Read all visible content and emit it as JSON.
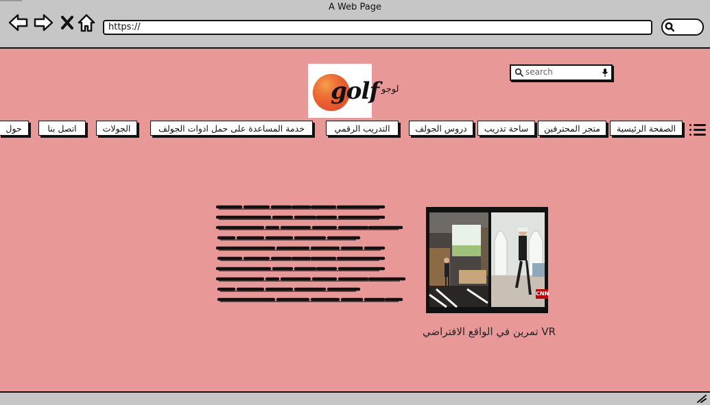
{
  "window": {
    "title": "A Web Page"
  },
  "address_bar": {
    "url": "https://"
  },
  "header": {
    "search_placeholder": "search",
    "logo_text": "golf",
    "logo_label": "لوجو"
  },
  "nav": {
    "items": [
      "الصفحة الرئيسية",
      "متجر المحترفين",
      "ساحة تدريب",
      "دروس الجولف",
      "التدريب الرقمي",
      "خدمة المساعدة على حمل ادوات الجولف",
      "الجولات",
      "اتصل بنا",
      "حول"
    ]
  },
  "feature": {
    "video_badge": "CNN",
    "caption": "VR تمرين في الواقع الافتراضي"
  },
  "colors": {
    "page_background": "#e99898",
    "chrome": "#c6c6c6",
    "logo_accent": "#e8522b"
  },
  "icons": [
    "back-arrow-icon",
    "forward-arrow-icon",
    "close-icon",
    "home-icon",
    "search-icon",
    "microphone-icon",
    "hamburger-menu-icon",
    "resize-grip-icon"
  ]
}
